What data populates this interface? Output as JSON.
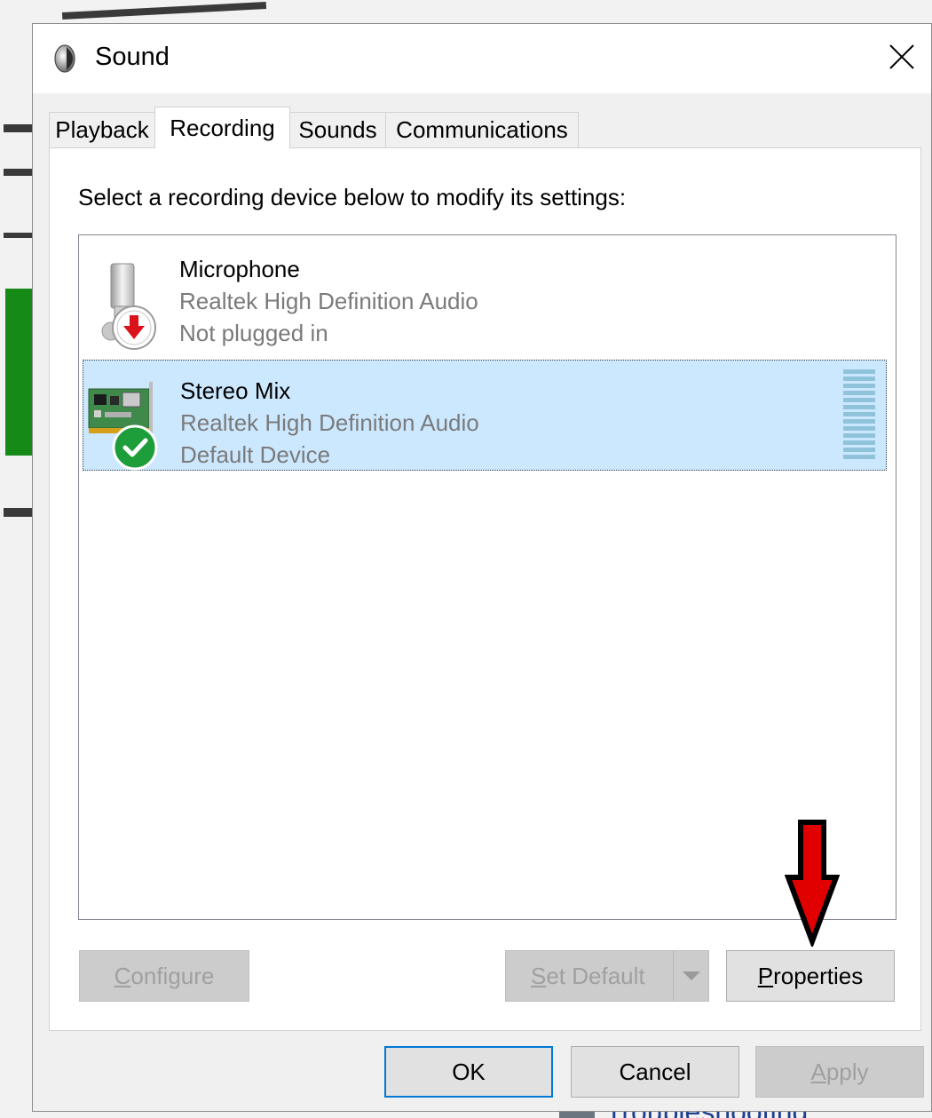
{
  "background": {
    "partial_text": "Troubleshooting"
  },
  "dialog": {
    "title": "Sound",
    "close_glyph": "✕",
    "tabs": [
      {
        "label": "Playback",
        "active": false
      },
      {
        "label": "Recording",
        "active": true
      },
      {
        "label": "Sounds",
        "active": false
      },
      {
        "label": "Communications",
        "active": false
      }
    ],
    "instructions": "Select a recording device below to modify its settings:",
    "devices": [
      {
        "name": "Microphone",
        "driver": "Realtek High Definition Audio",
        "status": "Not plugged in",
        "icon": "microphone-icon",
        "badge": "unplugged-badge",
        "selected": false
      },
      {
        "name": "Stereo Mix",
        "driver": "Realtek High Definition Audio",
        "status": "Default Device",
        "icon": "sound-card-icon",
        "badge": "default-check-badge",
        "selected": true
      }
    ],
    "buttons": {
      "configure": {
        "label": "Configure",
        "accel": "C",
        "rest": "onfigure",
        "enabled": false
      },
      "set_default": {
        "label": "Set Default",
        "accel": "S",
        "rest": "et Default",
        "enabled": false
      },
      "properties": {
        "label": "Properties",
        "accel": "P",
        "rest": "roperties",
        "enabled": true
      },
      "ok": {
        "label": "OK",
        "enabled": true
      },
      "cancel": {
        "label": "Cancel",
        "enabled": true
      },
      "apply": {
        "label": "Apply",
        "accel": "A",
        "rest": "pply",
        "enabled": false
      }
    }
  },
  "colors": {
    "selection": "#cce8ff",
    "focus_border": "#0078d7",
    "annotation_arrow": "#e00000",
    "default_badge": "#1e9e3a",
    "unplugged_arrow": "#d9121c"
  }
}
